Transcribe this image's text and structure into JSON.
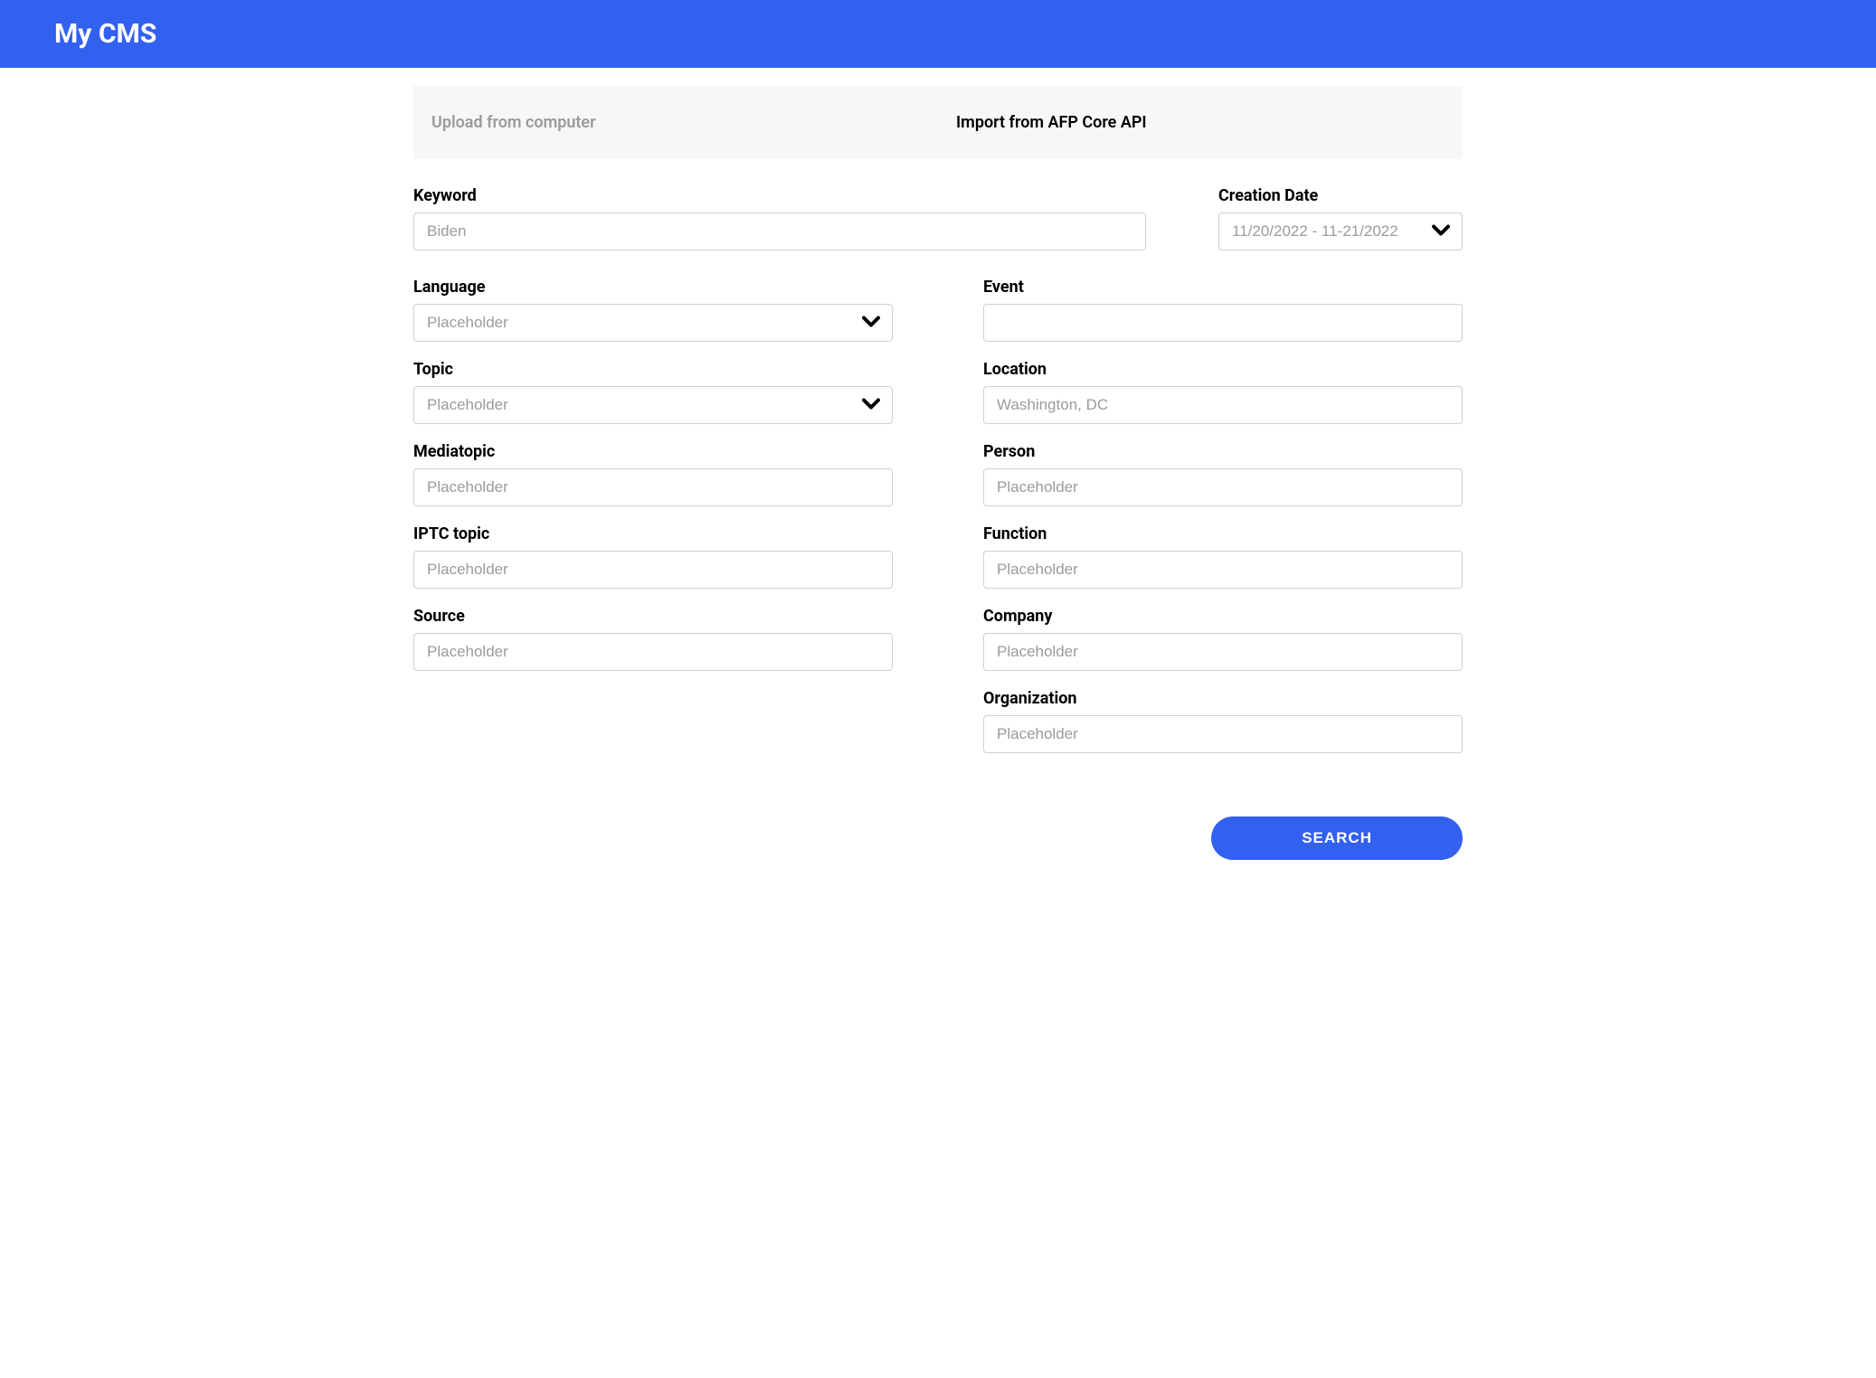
{
  "header": {
    "title": "My CMS"
  },
  "tabs": {
    "upload": "Upload from computer",
    "import": "Import from AFP Core API"
  },
  "form": {
    "keyword": {
      "label": "Keyword",
      "placeholder": "Biden",
      "value": ""
    },
    "creation_date": {
      "label": "Creation Date",
      "placeholder": "11/20/2022 - 11-21/2022",
      "value": ""
    },
    "language": {
      "label": "Language",
      "placeholder": "Placeholder",
      "value": ""
    },
    "topic": {
      "label": "Topic",
      "placeholder": "Placeholder",
      "value": ""
    },
    "mediatopic": {
      "label": "Mediatopic",
      "placeholder": "Placeholder",
      "value": ""
    },
    "iptc_topic": {
      "label": "IPTC topic",
      "placeholder": "Placeholder",
      "value": ""
    },
    "source": {
      "label": "Source",
      "placeholder": "Placeholder",
      "value": ""
    },
    "event": {
      "label": "Event",
      "placeholder": "",
      "value": ""
    },
    "location": {
      "label": "Location",
      "placeholder": "Washington, DC",
      "value": ""
    },
    "person": {
      "label": "Person",
      "placeholder": "Placeholder",
      "value": ""
    },
    "function": {
      "label": "Function",
      "placeholder": "Placeholder",
      "value": ""
    },
    "company": {
      "label": "Company",
      "placeholder": "Placeholder",
      "value": ""
    },
    "organization": {
      "label": "Organization",
      "placeholder": "Placeholder",
      "value": ""
    }
  },
  "buttons": {
    "search": "SEARCH"
  }
}
